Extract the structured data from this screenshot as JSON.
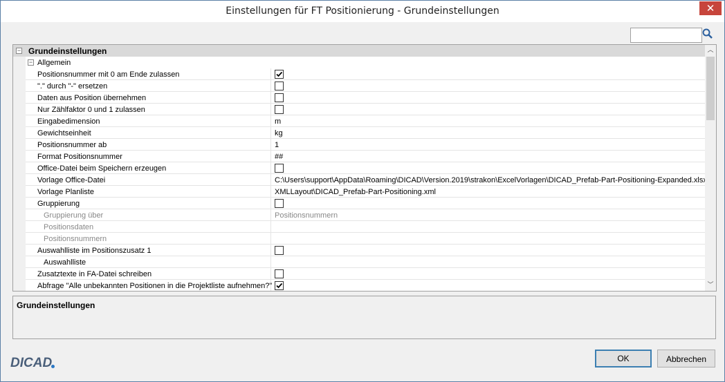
{
  "window": {
    "title": "Einstellungen für FT Positionierung - Grundeinstellungen",
    "close_symbol": "✕"
  },
  "search": {
    "value": "",
    "icon": "magnifier-icon"
  },
  "grid": {
    "category": {
      "label": "Grundeinstellungen",
      "expander": "⊟"
    },
    "subcategory": {
      "label": "Allgemein",
      "expander": "⊟"
    },
    "rows": [
      {
        "name": "Positionsnummer mit 0 am Ende zulassen",
        "type": "checkbox",
        "checked": true
      },
      {
        "name": "\".\" durch \"-\" ersetzen",
        "type": "checkbox",
        "checked": false
      },
      {
        "name": "Daten aus Position übernehmen",
        "type": "checkbox",
        "checked": false
      },
      {
        "name": "Nur Zählfaktor 0 und 1 zulassen",
        "type": "checkbox",
        "checked": false
      },
      {
        "name": "Eingabedimension",
        "type": "text",
        "value": "m"
      },
      {
        "name": "Gewichtseinheit",
        "type": "text",
        "value": "kg"
      },
      {
        "name": "Positionsnummer ab",
        "type": "text",
        "value": "1"
      },
      {
        "name": "Format Positionsnummer",
        "type": "text",
        "value": "##"
      },
      {
        "name": "Office-Datei beim Speichern erzeugen",
        "type": "checkbox",
        "checked": false
      },
      {
        "name": "Vorlage  Office-Datei",
        "type": "text",
        "value": "C:\\Users\\support\\AppData\\Roaming\\DICAD\\Version.2019\\strakon\\ExcelVorlagen\\DICAD_Prefab-Part-Positioning-Expanded.xlsx"
      },
      {
        "name": "Vorlage Planliste",
        "type": "text",
        "value": "XMLLayout\\DICAD_Prefab-Part-Positioning.xml"
      },
      {
        "name": "Gruppierung",
        "type": "checkbox",
        "checked": false
      },
      {
        "name": "Gruppierung über",
        "type": "text",
        "value": "Positionsnummern",
        "indent": true,
        "dim": true
      },
      {
        "name": "Positionsdaten",
        "type": "text",
        "value": "",
        "indent": true,
        "dim": true
      },
      {
        "name": "Positionsnummern",
        "type": "text",
        "value": "",
        "indent": true,
        "dim": true
      },
      {
        "name": "Auswahlliste im Positionszusatz 1",
        "type": "checkbox",
        "checked": false
      },
      {
        "name": "Auswahlliste",
        "type": "text",
        "value": "",
        "indent": true,
        "dim": false
      },
      {
        "name": "Zusatztexte in FA-Datei schreiben",
        "type": "checkbox",
        "checked": false
      },
      {
        "name": "Abfrage \"Alle unbekannten Positionen in die Projektliste aufnehmen?\"",
        "type": "checkbox",
        "checked": true
      }
    ]
  },
  "scrollbar": {
    "up_symbol": "︿",
    "down_symbol": "﹀"
  },
  "description": {
    "title": "Grundeinstellungen"
  },
  "logo": {
    "text": "DICAD"
  },
  "buttons": {
    "ok": "OK",
    "cancel": "Abbrechen"
  },
  "colors": {
    "accent": "#3c7fb1",
    "close": "#c7453c",
    "category_bg": "#d9d9d9"
  }
}
